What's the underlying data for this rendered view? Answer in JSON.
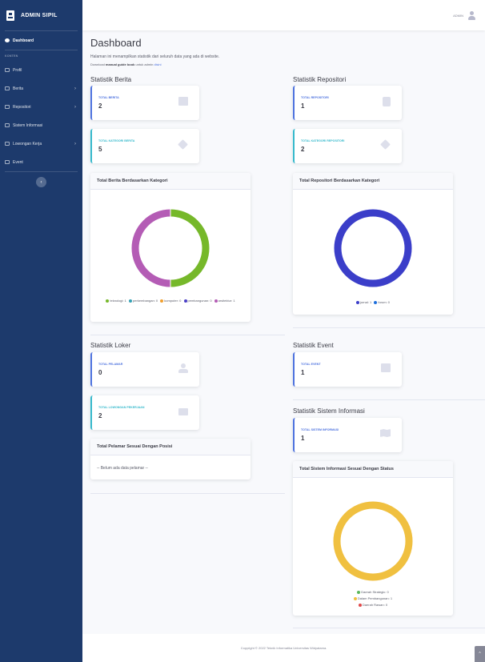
{
  "brand": {
    "name": "ADMIN SIPIL"
  },
  "sidebar": {
    "dashboard": "Dashboard",
    "heading": "KONTEN",
    "items": [
      {
        "label": "Profil",
        "chevron": false
      },
      {
        "label": "Berita",
        "chevron": true
      },
      {
        "label": "Repositori",
        "chevron": true
      },
      {
        "label": "Sistem Informasi",
        "chevron": false
      },
      {
        "label": "Lowongan Kerja",
        "chevron": true
      },
      {
        "label": "Event",
        "chevron": false
      }
    ],
    "toggle_glyph": "‹",
    "chevron_glyph": "›"
  },
  "topbar": {
    "user_name": "ADMIN"
  },
  "header": {
    "title": "Dashboard",
    "subtitle": "Halaman ini menampilkan statistik dari seluruh data yang ada di website.",
    "download_prefix": "Download",
    "download_bold": "manual guide book",
    "download_mid": "untuk admin",
    "download_link": "disini"
  },
  "berita": {
    "title": "Statistik Berita",
    "total_label": "TOTAL BERITA",
    "total_value": "2",
    "kategori_label": "TOTAL KATEGORI BERITA",
    "kategori_value": "5",
    "chart_title": "Total Berita Berdasarkan Kategori",
    "legend": [
      {
        "label": "teknologi: 1",
        "color": "#76b82a"
      },
      {
        "label": "perkembangan: 0",
        "color": "#36a2b5"
      },
      {
        "label": "komputer: 0",
        "color": "#f0a030"
      },
      {
        "label": "pembangunan: 0",
        "color": "#4b3fc7"
      },
      {
        "label": "arsitektur: 1",
        "color": "#b45cb5"
      }
    ]
  },
  "repositori": {
    "title": "Statistik Repositori",
    "total_label": "TOTAL REPOSITORI",
    "total_value": "1",
    "kategori_label": "TOTAL KATEGORI REPOSITORI",
    "kategori_value": "2",
    "chart_title": "Total Repositori Berdasarkan Kategori",
    "legend": [
      {
        "label": "jurnal: 1",
        "color": "#3b3ec9"
      },
      {
        "label": "forum: 0",
        "color": "#1e6fdc"
      }
    ]
  },
  "loker": {
    "title": "Statistik Loker",
    "pelamar_label": "TOTAL PELAMAR",
    "pelamar_value": "0",
    "lowongan_label": "TOTAL LOWONGAN PEKERJAAN",
    "lowongan_value": "2",
    "table_title": "Total Pelamar Sesuai Dengan Posisi",
    "empty_text": "-- Belum ada data pelamar --"
  },
  "event": {
    "title": "Statistik Event",
    "total_label": "TOTAL EVENT",
    "total_value": "1"
  },
  "sisinfo": {
    "title": "Statistik Sistem Informasi",
    "total_label": "TOTAL SISTEM INFORMASI",
    "total_value": "1",
    "chart_title": "Total Sistem Informasi Sesuai Dengan Status",
    "legend": [
      {
        "label": "Daerah Strategic: 0",
        "color": "#5cb85c"
      },
      {
        "label": "Dalam Pembangunan: 1",
        "color": "#f0c040"
      },
      {
        "label": "Daerah Rawan: 0",
        "color": "#e04848"
      }
    ]
  },
  "footer": {
    "copyright": "Copyright © 2022 Teknik Informatika Universitas Widyatama."
  },
  "scroll_glyph": "^",
  "chart_data": [
    {
      "type": "pie",
      "title": "Total Berita Berdasarkan Kategori",
      "categories": [
        "teknologi",
        "perkembangan",
        "komputer",
        "pembangunan",
        "arsitektur"
      ],
      "values": [
        1,
        0,
        0,
        0,
        1
      ],
      "colors": [
        "#76b82a",
        "#36a2b5",
        "#f0a030",
        "#4b3fc7",
        "#b45cb5"
      ],
      "legend": "bottom"
    },
    {
      "type": "pie",
      "title": "Total Repositori Berdasarkan Kategori",
      "categories": [
        "jurnal",
        "forum"
      ],
      "values": [
        1,
        0
      ],
      "colors": [
        "#3b3ec9",
        "#1e6fdc"
      ],
      "legend": "bottom"
    },
    {
      "type": "pie",
      "title": "Total Sistem Informasi Sesuai Dengan Status",
      "categories": [
        "Daerah Strategic",
        "Dalam Pembangunan",
        "Daerah Rawan"
      ],
      "values": [
        0,
        1,
        0
      ],
      "colors": [
        "#5cb85c",
        "#f0c040",
        "#e04848"
      ],
      "legend": "bottom"
    }
  ]
}
